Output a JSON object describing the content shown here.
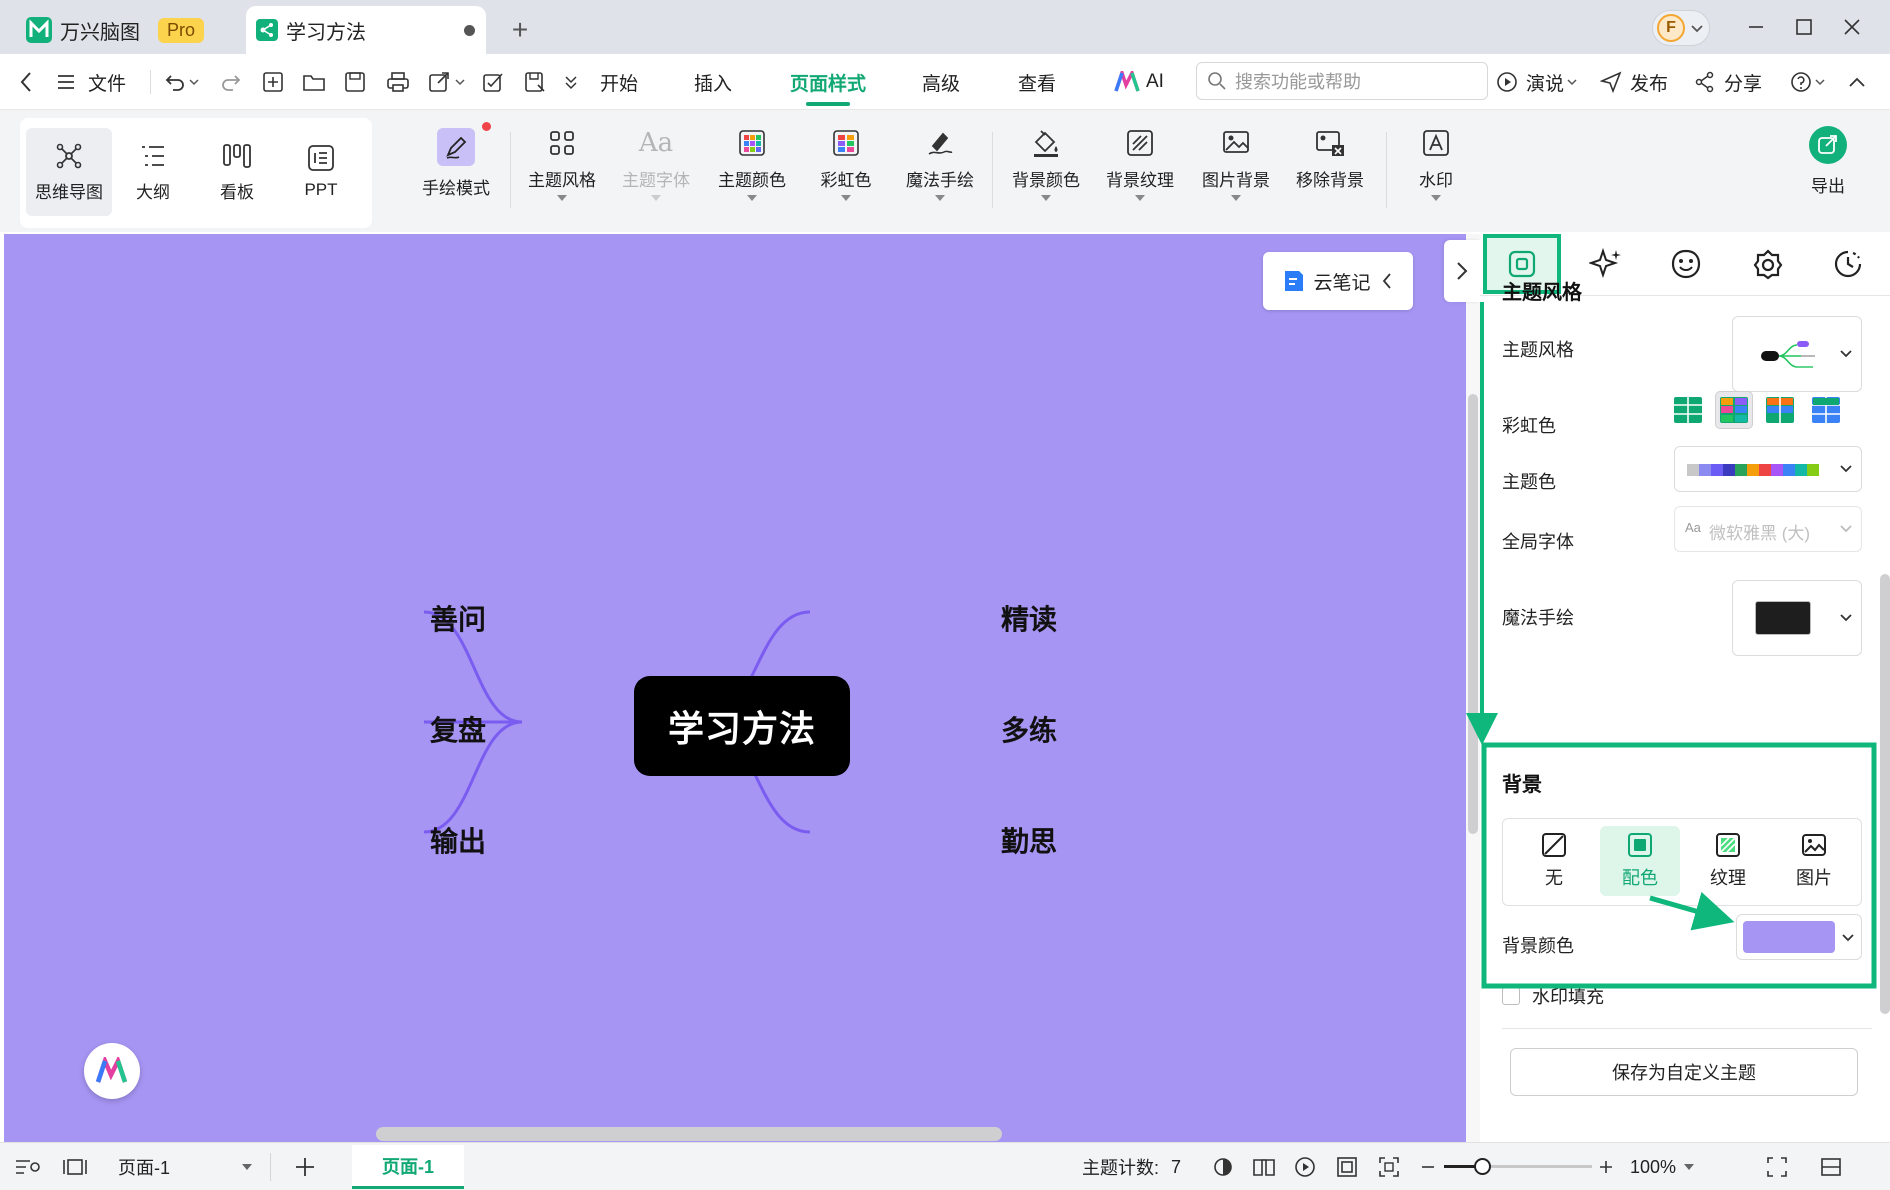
{
  "titlebar": {
    "app_name": "万兴脑图",
    "pro_badge": "Pro",
    "doc_tab": "学习方法",
    "new_tab": "+",
    "avatar_letter": "F"
  },
  "menu": {
    "file": "文件",
    "start": "开始",
    "insert": "插入",
    "page_style": "页面样式",
    "advanced": "高级",
    "view": "查看",
    "ai": "AI",
    "search_placeholder": "搜索功能或帮助",
    "present": "演说",
    "publish": "发布",
    "share": "分享",
    "active_tab": "页面样式"
  },
  "toolbar": {
    "view_modes": [
      "思维导图",
      "大纲",
      "看板",
      "PPT"
    ],
    "hand_draw": "手绘模式",
    "theme_style": "主题风格",
    "theme_font": "主题字体",
    "theme_color": "主题颜色",
    "rainbow": "彩虹色",
    "magic_draw": "魔法手绘",
    "bg_color": "背景颜色",
    "bg_texture": "背景纹理",
    "image_bg": "图片背景",
    "remove_bg": "移除背景",
    "watermark": "水印",
    "export": "导出"
  },
  "canvas": {
    "background_color": "#a695f3",
    "branch_color": "#7b5cf0",
    "cloud_notes": "云笔记",
    "central_topic": "学习方法",
    "left_topics": [
      "善问",
      "复盘",
      "输出"
    ],
    "right_topics": [
      "精读",
      "多练",
      "勤思"
    ]
  },
  "panel": {
    "theme_section": "主题风格",
    "theme_style_label": "主题风格",
    "rainbow_label": "彩虹色",
    "theme_color_label": "主题色",
    "global_font_label": "全局字体",
    "global_font_value": "微软雅黑 (大)",
    "global_font_prefix": "Aa",
    "magic_draw_label": "魔法手绘",
    "background_section": "背景",
    "bg_options": [
      "无",
      "配色",
      "纹理",
      "图片"
    ],
    "bg_selected": "配色",
    "bg_color_label": "背景颜色",
    "bg_color_value": "#a695f3",
    "watermark_fill": "水印填充",
    "save_custom_theme": "保存为自定义主题",
    "theme_palette": [
      "#c8c8c8",
      "#8a8af0",
      "#6a5cf5",
      "#3b3bc0",
      "#29a35a",
      "#f59e0b",
      "#ef4444",
      "#a855f7",
      "#3b82f6",
      "#14b8a6",
      "#84cc16"
    ]
  },
  "statusbar": {
    "page_select": "页面-1",
    "page_tab": "页面-1",
    "topic_count_label": "主题计数:",
    "topic_count": "7",
    "zoom": "100%"
  },
  "accent": "#12a874",
  "annotation_color": "#0fb77d"
}
